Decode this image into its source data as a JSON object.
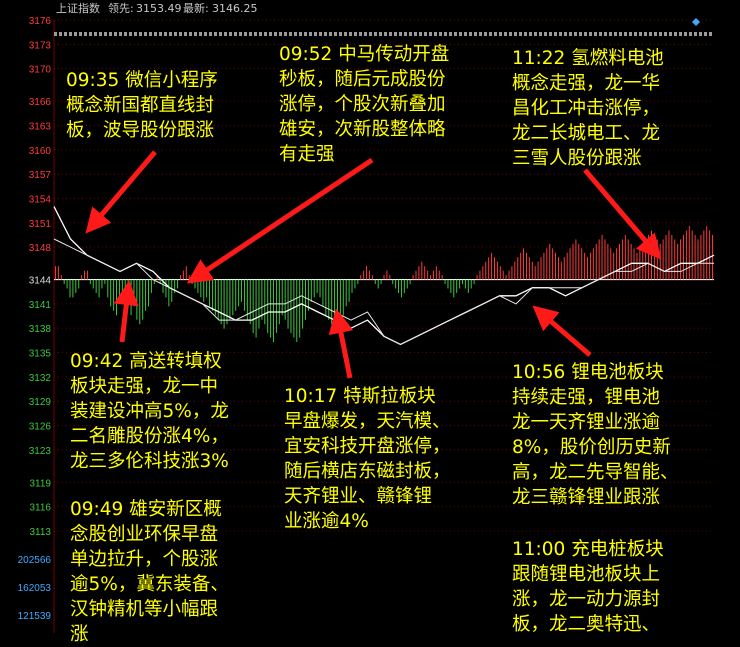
{
  "header": {
    "title": "上证指数",
    "lead_label": "领先:",
    "lead_value": "3153.49",
    "latest_label": "最新:",
    "latest_value": "3146.25"
  },
  "colors": {
    "background": "#000000",
    "up": "#ff3b3b",
    "down": "#3cc83c",
    "line_price": "#ffffff",
    "annotation": "#ffff00",
    "arrow": "#ff1a1a",
    "volume_label": "#3fa9ff",
    "grid": "#b00000"
  },
  "chart_data": {
    "type": "line",
    "title": "上证指数",
    "base": 3144,
    "ylim": [
      3113,
      3176
    ],
    "y_ticks": [
      3176,
      3173,
      3170,
      3166,
      3163,
      3160,
      3157,
      3154,
      3151,
      3148,
      3144,
      3141,
      3138,
      3135,
      3132,
      3129,
      3126,
      3123,
      3119,
      3116,
      3113
    ],
    "volume_ticks": [
      202566,
      162053,
      121539
    ],
    "x_index": [
      0,
      6,
      12,
      18,
      24,
      30,
      36,
      42,
      48,
      54,
      60,
      66,
      72,
      78,
      84,
      90,
      96,
      102,
      108,
      114,
      120,
      126,
      132,
      138,
      144,
      150,
      156,
      162,
      168,
      174,
      180,
      186,
      192,
      198,
      204,
      210,
      216,
      222,
      228,
      234,
      240
    ],
    "series": [
      {
        "values": [
          3153,
          3149,
          3147,
          3146,
          3145,
          3146,
          3145,
          3143,
          3142,
          3141,
          3140,
          3139,
          3139,
          3140,
          3140,
          3141,
          3140,
          3139,
          3138,
          3139,
          3137,
          3136,
          3137,
          3138,
          3139,
          3140,
          3141,
          3142,
          3142,
          3143,
          3143,
          3142,
          3143,
          3144,
          3145,
          3146,
          3146,
          3145,
          3146,
          3146,
          3147
        ]
      },
      {
        "values": [
          3149,
          3148,
          3147,
          3146,
          3145,
          3146,
          3144,
          3143,
          3142,
          3141,
          3139,
          3139,
          3140,
          3141,
          3141,
          3142,
          3141,
          3140,
          3139,
          3140,
          3137,
          3136,
          3137,
          3138,
          3139,
          3140,
          3141,
          3142,
          3141,
          3143,
          3143,
          3143,
          3143,
          3144,
          3145,
          3145,
          3146,
          3145,
          3145,
          3146,
          3146
        ]
      }
    ],
    "bars": [
      3,
      3,
      1,
      -1,
      -2,
      -4,
      -4,
      -3,
      -2,
      1,
      2,
      2,
      -1,
      -2,
      -3,
      -4,
      -2,
      -1,
      -4,
      -6,
      -7,
      -8,
      -5,
      -3,
      -4,
      -6,
      -8,
      -6,
      -9,
      -10,
      -9,
      -7,
      -6,
      -3,
      -1,
      1,
      -1,
      -3,
      -4,
      -6,
      -5,
      -3,
      -2,
      1,
      2,
      3,
      1,
      -1,
      -2,
      -3,
      -4,
      -5,
      -4,
      -6,
      -7,
      -8,
      -9,
      -10,
      -11,
      -10,
      -9,
      -8,
      -7,
      -6,
      -5,
      -7,
      -9,
      -10,
      -12,
      -13,
      -11,
      -9,
      -10,
      -12,
      -13,
      -14,
      -12,
      -10,
      -8,
      -9,
      -11,
      -12,
      -13,
      -14,
      -13,
      -11,
      -9,
      -7,
      -5,
      -4,
      -3,
      -4,
      -6,
      -8,
      -9,
      -10,
      -11,
      -12,
      -10,
      -8,
      -6,
      -5,
      -3,
      -2,
      -1,
      1,
      2,
      3,
      2,
      1,
      -1,
      -2,
      -1,
      1,
      2,
      1,
      -1,
      -2,
      -3,
      -4,
      -3,
      -2,
      -1,
      1,
      2,
      3,
      4,
      3,
      2,
      1,
      2,
      3,
      2,
      1,
      -1,
      -2,
      -3,
      -4,
      -3,
      -2,
      -1,
      -2,
      -3,
      -2,
      -1,
      1,
      2,
      3,
      4,
      5,
      6,
      5,
      4,
      3,
      2,
      1,
      2,
      3,
      4,
      5,
      6,
      7,
      6,
      5,
      4,
      3,
      4,
      5,
      6,
      7,
      8,
      7,
      6,
      5,
      4,
      5,
      6,
      7,
      8,
      9,
      8,
      7,
      6,
      5,
      6,
      7,
      8,
      9,
      10,
      9,
      8,
      7,
      6,
      7,
      8,
      9,
      10,
      9,
      8,
      7,
      6,
      7,
      8,
      9,
      10,
      11,
      10,
      9,
      8,
      9,
      10,
      11,
      10,
      9,
      8,
      9,
      10,
      11,
      12,
      11,
      10,
      9,
      10,
      11,
      12,
      11,
      10
    ]
  },
  "annotations": [
    {
      "lines": [
        "09:35 微信小程序",
        "概念新国都直线封",
        "板，波导股份跟涨"
      ]
    },
    {
      "lines": [
        "09:52 中马传动开盘",
        "秒板，随后元成股份",
        "涨停，个股次新叠加",
        "雄安，次新股整体略",
        "有走强"
      ]
    },
    {
      "lines": [
        "11:22 氢燃料电池",
        "概念走强，龙一华",
        "昌化工冲击涨停，",
        "龙二长城电工、龙",
        "三雪人股份跟涨"
      ]
    },
    {
      "lines": [
        "09:42 高送转填权",
        "板块走强，龙一中",
        "装建设冲高5%，龙",
        "二名雕股份涨4%，",
        "龙三多伦科技涨3%"
      ]
    },
    {
      "lines": [
        "10:17 特斯拉板块",
        "早盘爆发，天汽模、",
        "宜安科技开盘涨停，",
        "随后横店东磁封板，",
        "天齐锂业、赣锋锂",
        "业涨逾4%"
      ]
    },
    {
      "lines": [
        "10:56 锂电池板块",
        "持续走强，锂电池",
        "龙一天齐锂业涨逾",
        "8%，股价创历史新",
        "高，龙二先导智能、",
        "龙三赣锋锂业跟涨"
      ]
    },
    {
      "lines": [
        "09:49 雄安新区概",
        "念股创业环保早盘",
        "单边拉升，个股涨",
        "逾5%，冀东装备、",
        "汉钟精机等小幅跟",
        "涨"
      ]
    },
    {
      "lines": [
        "11:00 充电桩板块",
        "跟随锂电池板块上",
        "涨，龙一动力源封",
        "板，龙二奥特迅、"
      ]
    }
  ]
}
